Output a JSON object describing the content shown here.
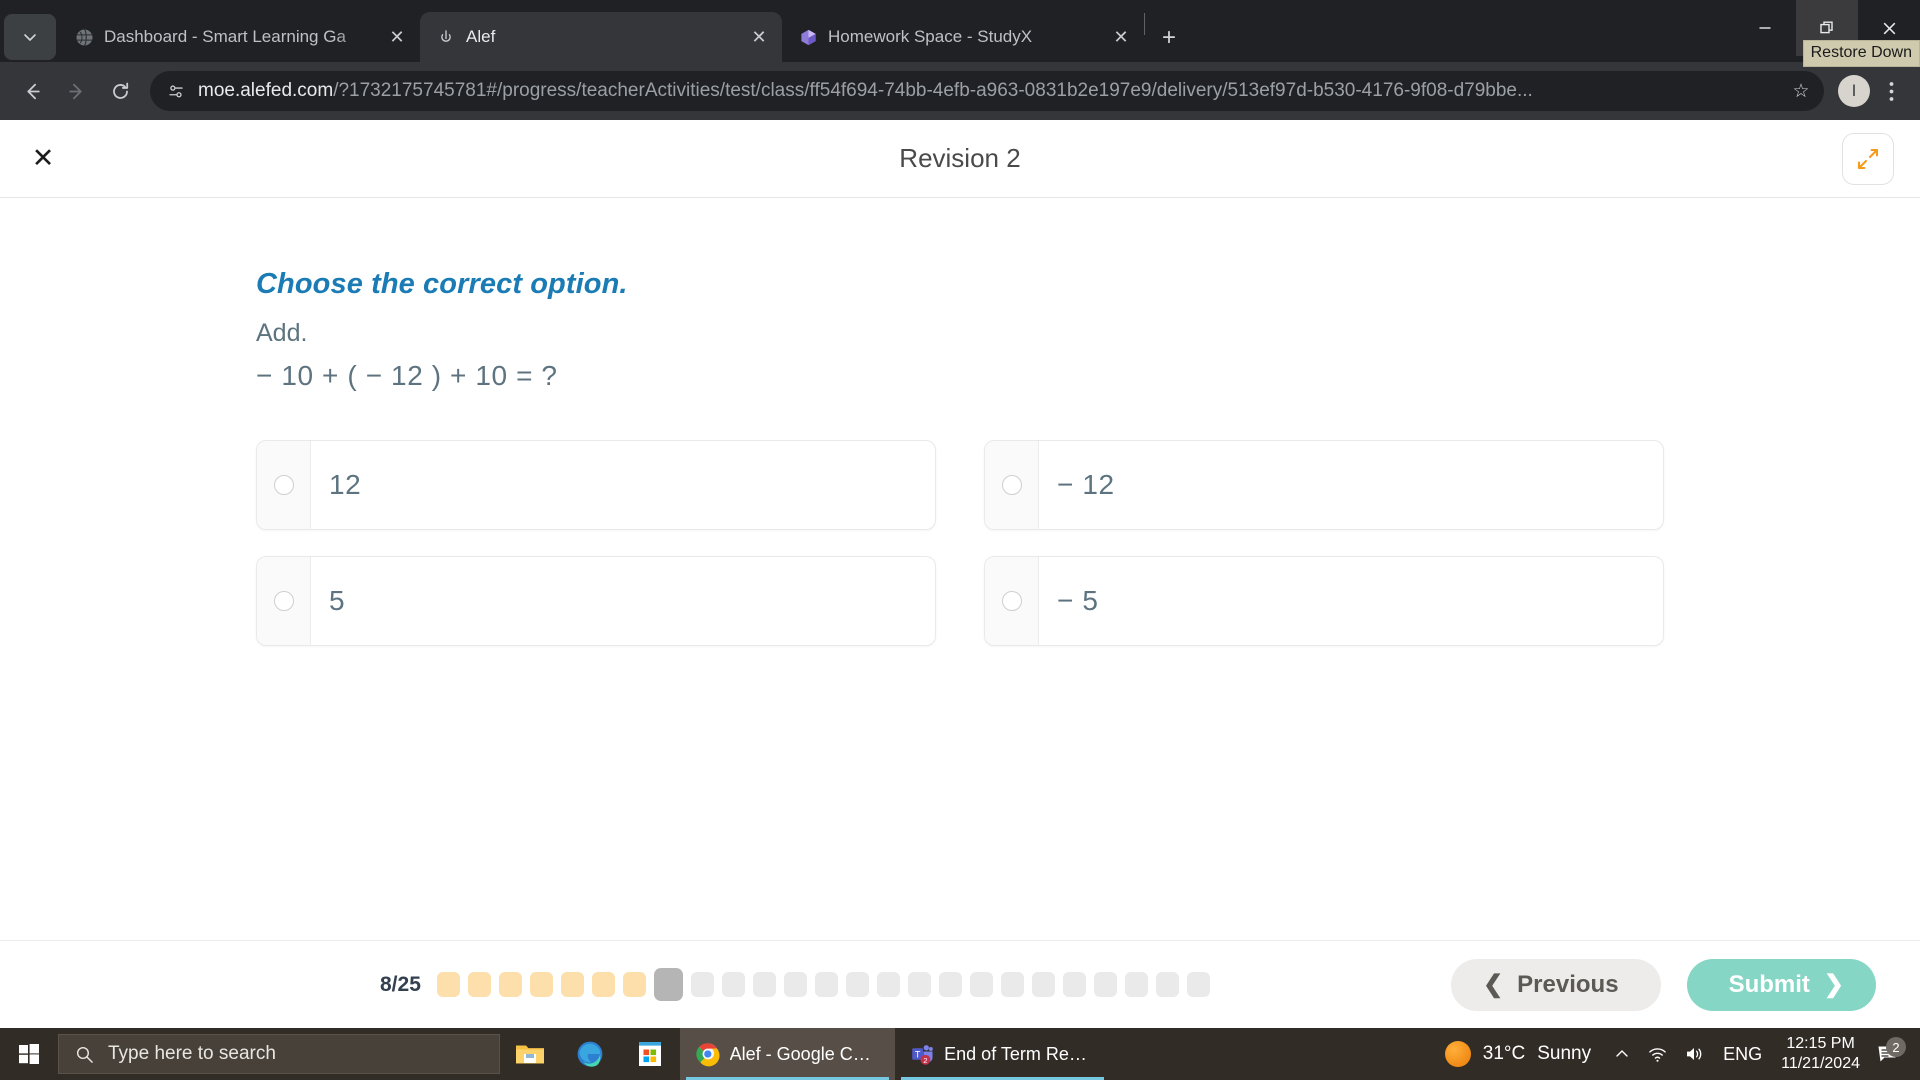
{
  "browser": {
    "tab_search_icon": "chevron-down-icon",
    "tabs": [
      {
        "title": "Dashboard - Smart Learning Ga",
        "favicon": "globe-icon",
        "active": false
      },
      {
        "title": "Alef",
        "favicon": "alef-icon",
        "active": true
      },
      {
        "title": "Homework Space - StudyX",
        "favicon": "studyx-icon",
        "active": false
      }
    ],
    "new_tab_label": "+",
    "window_controls": {
      "minimize": "minimize-icon",
      "restore": "restore-icon",
      "close": "close-icon",
      "tooltip": "Restore Down"
    },
    "toolbar": {
      "back": "back-arrow-icon",
      "forward": "forward-arrow-icon",
      "reload": "reload-icon",
      "site_info_icon": "site-settings-icon",
      "url": "moe.alefed.com/?1732175745781#/progress/teacherActivities/test/class/ff54f694-74bb-4efb-a963-0831b2e197e9/delivery/513ef97d-b530-4176-9f08-d79bbe...",
      "url_domain": "moe.alefed.com",
      "url_path": "/?1732175745781#/progress/teacherActivities/test/class/ff54f694-74bb-4efb-a963-0831b2e197e9/delivery/513ef97d-b530-4176-9f08-d79bbe...",
      "bookmark": "star-icon",
      "profile_initial": "I",
      "menu": "kebab-menu-icon"
    }
  },
  "app": {
    "header": {
      "close_label": "✕",
      "title": "Revision 2",
      "expand_icon": "expand-arrows-icon"
    },
    "question": {
      "prompt": "Choose the correct option.",
      "instruction": "Add.",
      "equation": "− 10 + ( − 12 ) + 10 = ?",
      "options": [
        {
          "text": "12",
          "selected": false
        },
        {
          "text": "− 12",
          "selected": false
        },
        {
          "text": "5",
          "selected": false
        },
        {
          "text": "− 5",
          "selected": false
        }
      ]
    },
    "footer": {
      "progress_label": "8/25",
      "current_index": 8,
      "total": 25,
      "completed": 7,
      "previous_label": "Previous",
      "previous_icon": "chevron-left-icon",
      "submit_label": "Submit",
      "submit_icon": "chevron-right-icon",
      "colors": {
        "done": "#fcdfab",
        "current": "#b5b5b5",
        "pending": "#eaeaea",
        "submit": "#86d6c6"
      }
    }
  },
  "taskbar": {
    "start_icon": "windows-start-icon",
    "search_icon": "search-icon",
    "search_placeholder": "Type here to search",
    "pinned": [
      {
        "name": "file-explorer-icon"
      },
      {
        "name": "microsoft-edge-icon"
      },
      {
        "name": "microsoft-store-icon"
      }
    ],
    "tasks": [
      {
        "label": "Alef - Google Chro...",
        "icon": "chrome-icon",
        "active": true,
        "badge": ""
      },
      {
        "label": "End of Term Review...",
        "icon": "teams-icon",
        "active": false,
        "badge": "2"
      }
    ],
    "tray": {
      "weather_temp": "31°C",
      "weather_desc": "Sunny",
      "weather_icon": "sun-icon",
      "overflow_icon": "chevron-up-icon",
      "network_icon": "wifi-icon",
      "volume_icon": "speaker-icon",
      "language": "ENG",
      "time": "12:15 PM",
      "date": "11/21/2024",
      "notifications_icon": "chat-bubble-icon",
      "notifications_count": "2"
    }
  }
}
